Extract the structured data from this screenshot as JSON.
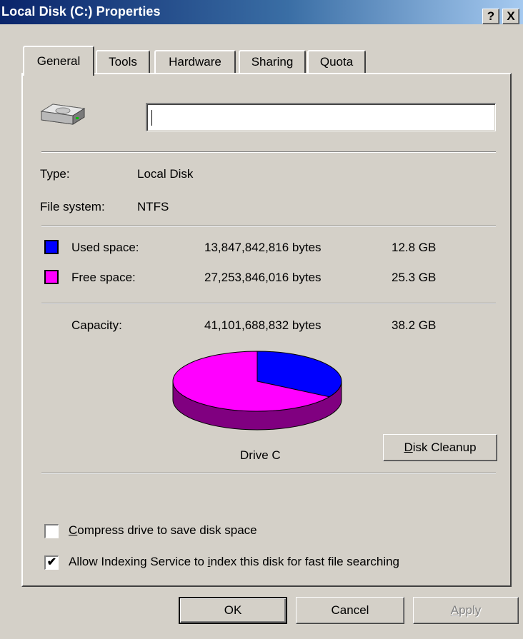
{
  "window": {
    "title": "Local Disk (C:) Properties",
    "help_label": "?",
    "close_label": "X"
  },
  "tabs": [
    {
      "label": "General",
      "active": true
    },
    {
      "label": "Tools",
      "active": false
    },
    {
      "label": "Hardware",
      "active": false
    },
    {
      "label": "Sharing",
      "active": false
    },
    {
      "label": "Quota",
      "active": false
    }
  ],
  "general": {
    "volume_name_value": "",
    "type_label": "Type:",
    "type_value": "Local Disk",
    "filesystem_label": "File system:",
    "filesystem_value": "NTFS",
    "used": {
      "label": "Used space:",
      "bytes": "13,847,842,816 bytes",
      "size": "12.8 GB",
      "color": "#0000ff"
    },
    "free": {
      "label": "Free space:",
      "bytes": "27,253,846,016 bytes",
      "size": "25.3 GB",
      "color": "#ff00ff"
    },
    "capacity": {
      "label": "Capacity:",
      "bytes": "41,101,688,832 bytes",
      "size": "38.2 GB"
    },
    "drive_label": "Drive C",
    "disk_cleanup_pre": "",
    "disk_cleanup_key": "D",
    "disk_cleanup_post": "isk Cleanup",
    "compress": {
      "key": "C",
      "rest": "ompress drive to save disk space",
      "checked": false
    },
    "indexing": {
      "pre": "Allow Indexing Service to ",
      "key": "i",
      "post": "ndex this disk for fast file searching",
      "checked": true,
      "check_mark": "✔"
    }
  },
  "buttons": {
    "ok": "OK",
    "cancel": "Cancel",
    "apply_key": "A",
    "apply_rest": "pply"
  },
  "chart_data": {
    "type": "pie",
    "title": "",
    "categories": [
      "Used space",
      "Free space"
    ],
    "values": [
      13847842816,
      27253846016
    ],
    "colors": [
      "#0000ff",
      "#ff00ff"
    ],
    "shadow_colors": [
      "#000080",
      "#800080"
    ]
  }
}
